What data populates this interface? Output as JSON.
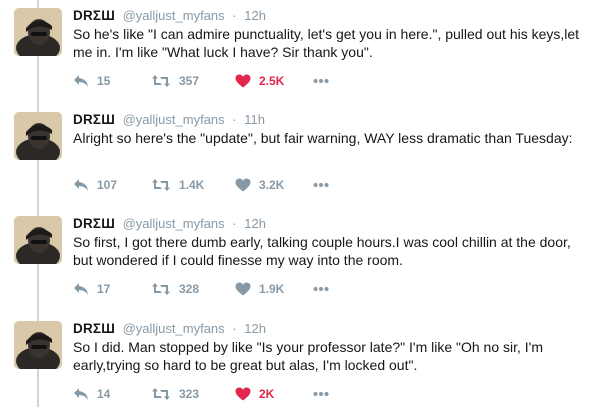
{
  "colors": {
    "text": "#14171a",
    "muted": "#8899a6",
    "liked": "#e2264d",
    "thread_line": "#ccd6dd"
  },
  "tweets": [
    {
      "name": "DRΣШ",
      "handle": "@yalljust_myfans",
      "separator": "·",
      "time": "11h",
      "text": "Alright so here's the \"update\", but fair warning, WAY less dramatic than Tuesday:",
      "replies": "107",
      "retweets": "1.4K",
      "likes": "3.2K",
      "liked": false
    },
    {
      "name": "DRΣШ",
      "handle": "@yalljust_myfans",
      "separator": "·",
      "time": "12h",
      "text": "So first, I got there dumb early, talking couple hours.I was cool chillin at the door, but wondered if I could finesse my way into the room.",
      "replies": "17",
      "retweets": "328",
      "likes": "1.9K",
      "liked": false
    },
    {
      "name": "DRΣШ",
      "handle": "@yalljust_myfans",
      "separator": "·",
      "time": "12h",
      "text": "So I did. Man stopped by like \"Is your professor late?\" I'm like \"Oh no sir, I'm early,trying so hard to be great but alas, I'm locked out\".",
      "replies": "14",
      "retweets": "323",
      "likes": "2K",
      "liked": true
    },
    {
      "name": "DRΣШ",
      "handle": "@yalljust_myfans",
      "separator": "·",
      "time": "12h",
      "text": "So he's like \"I can admire punctuality, let's get you in here.\", pulled out his keys,let me in. I'm like \"What luck I have? Sir thank you\".",
      "replies": "15",
      "retweets": "357",
      "likes": "2.5K",
      "liked": true
    }
  ],
  "icons": {
    "reply": "reply-icon",
    "retweet": "retweet-icon",
    "like": "heart-icon",
    "more": "more-dots-icon"
  }
}
